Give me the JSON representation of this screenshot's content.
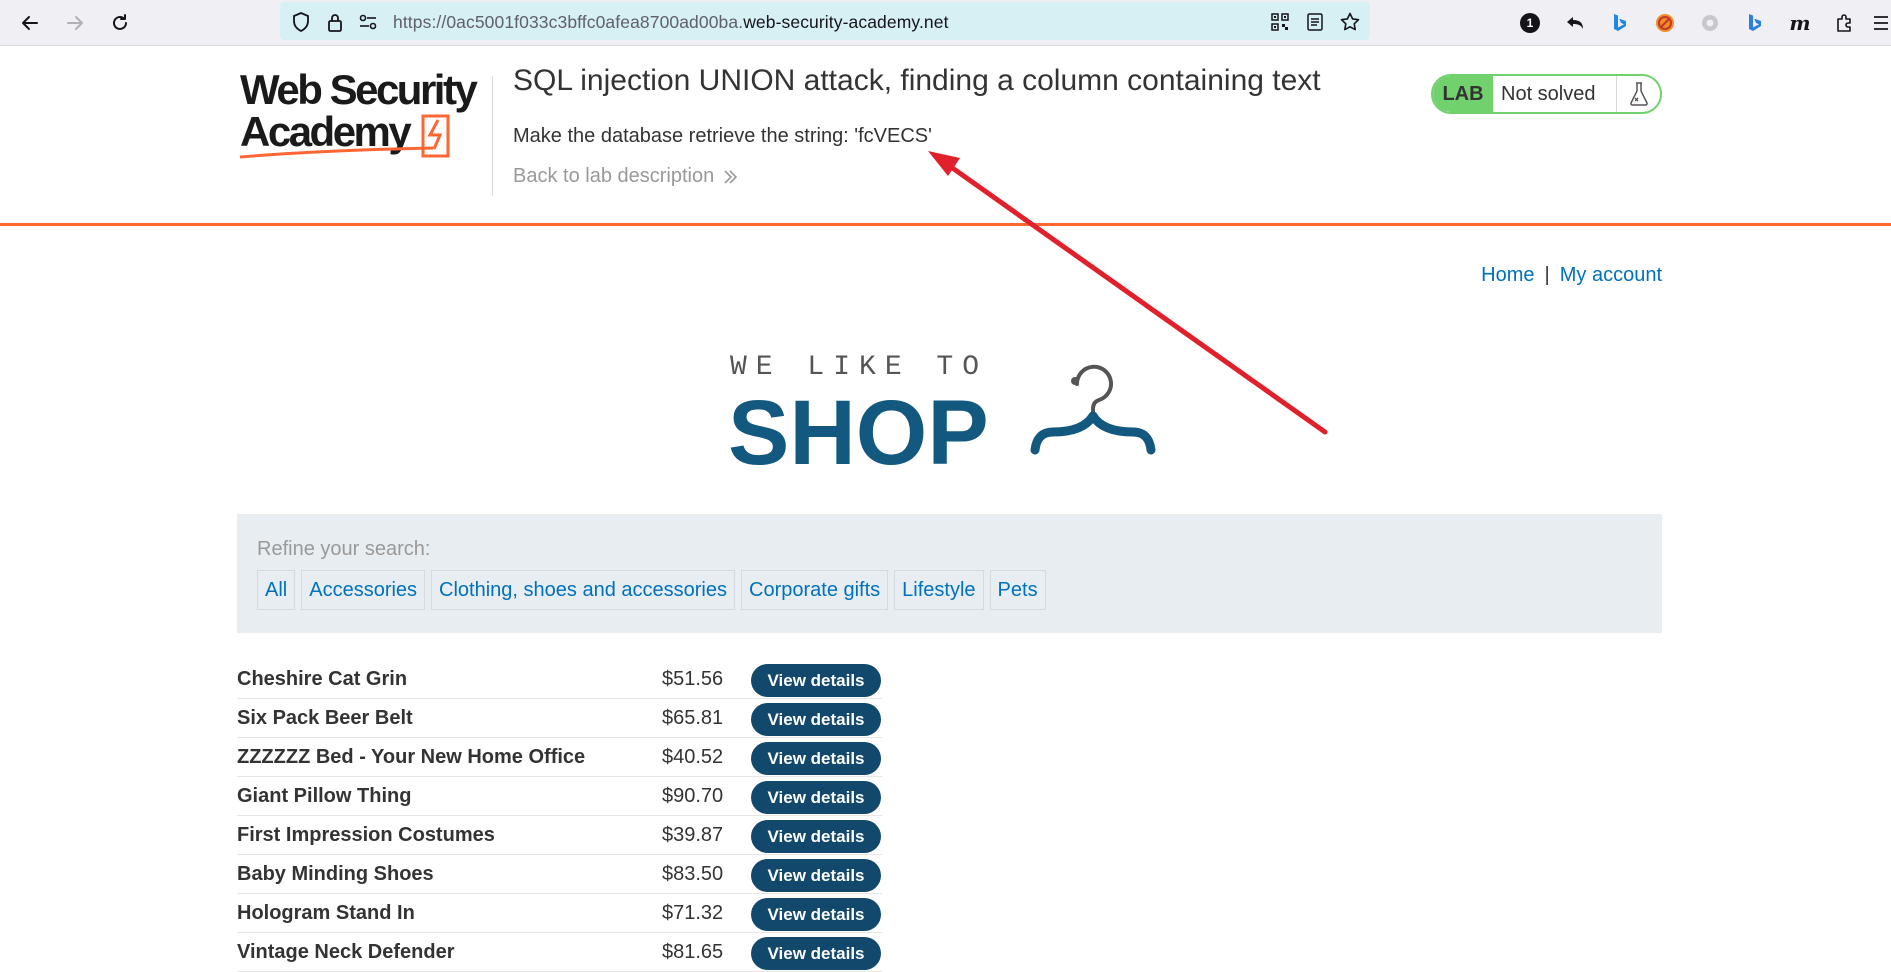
{
  "browser": {
    "url_prefix": "https://0ac5001f033c3bffc0afea8700ad00ba.",
    "url_host": "web-security-academy.net",
    "badge_count": "1"
  },
  "lab": {
    "logo_line1": "Web Security",
    "logo_line2": "Academy",
    "title": "SQL injection UNION attack, finding a column containing text",
    "goal": "Make the database retrieve the string: 'fcVECS'",
    "back_link": "Back to lab description",
    "status_label": "LAB",
    "status_text": "Not solved",
    "accent_color": "#ff6633",
    "status_color": "#70d16d"
  },
  "nav": {
    "home": "Home",
    "separator": "|",
    "my_account": "My account"
  },
  "banner": {
    "tagline": "WE LIKE TO",
    "word": "SHOP",
    "color": "#12587f"
  },
  "filter": {
    "label": "Refine your search:",
    "categories": [
      "All",
      "Accessories",
      "Clothing, shoes and accessories",
      "Corporate gifts",
      "Lifestyle",
      "Pets"
    ]
  },
  "products": [
    {
      "name": "Cheshire Cat Grin",
      "price": "$51.56",
      "button": "View details"
    },
    {
      "name": "Six Pack Beer Belt",
      "price": "$65.81",
      "button": "View details"
    },
    {
      "name": "ZZZZZZ Bed - Your New Home Office",
      "price": "$40.52",
      "button": "View details"
    },
    {
      "name": "Giant Pillow Thing",
      "price": "$90.70",
      "button": "View details"
    },
    {
      "name": "First Impression Costumes",
      "price": "$39.87",
      "button": "View details"
    },
    {
      "name": "Baby Minding Shoes",
      "price": "$83.50",
      "button": "View details"
    },
    {
      "name": "Hologram Stand In",
      "price": "$71.32",
      "button": "View details"
    },
    {
      "name": "Vintage Neck Defender",
      "price": "$81.65",
      "button": "View details"
    }
  ],
  "annotation": {
    "arrow_color": "#e0202a"
  }
}
